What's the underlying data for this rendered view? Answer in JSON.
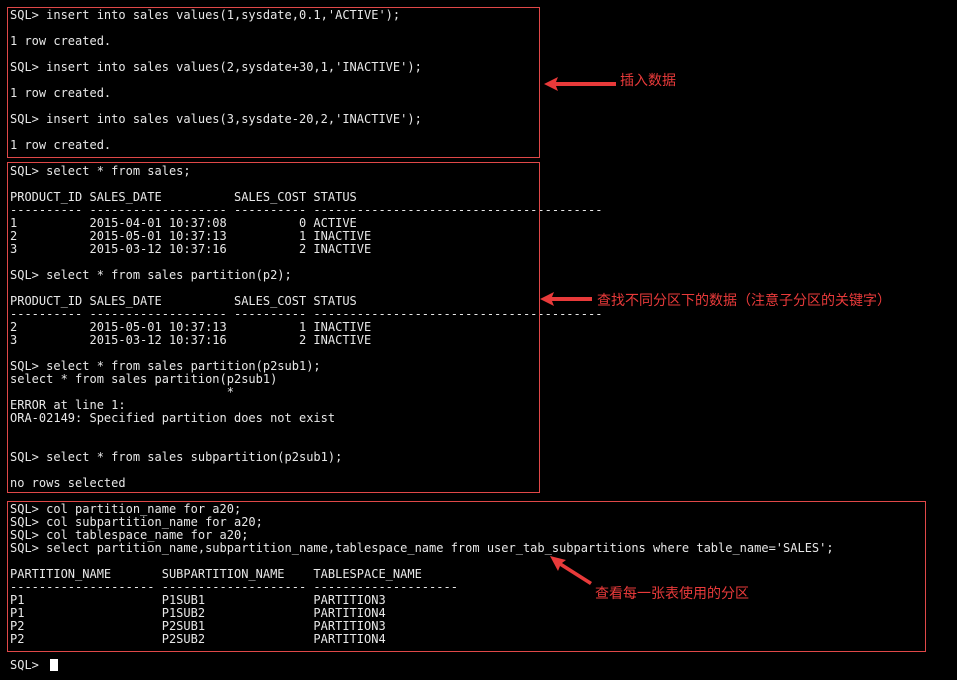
{
  "terminal": {
    "lines": [
      "SQL> insert into sales values(1,sysdate,0.1,'ACTIVE');",
      "",
      "1 row created.",
      "",
      "SQL> insert into sales values(2,sysdate+30,1,'INACTIVE');",
      "",
      "1 row created.",
      "",
      "SQL> insert into sales values(3,sysdate-20,2,'INACTIVE');",
      "",
      "1 row created.",
      "",
      "SQL> select * from sales;",
      "",
      "PRODUCT_ID SALES_DATE          SALES_COST STATUS",
      "---------- ------------------- ---------- ----------------------------------------",
      "1          2015-04-01 10:37:08          0 ACTIVE",
      "2          2015-05-01 10:37:13          1 INACTIVE",
      "3          2015-03-12 10:37:16          2 INACTIVE",
      "",
      "SQL> select * from sales partition(p2);",
      "",
      "PRODUCT_ID SALES_DATE          SALES_COST STATUS",
      "---------- ------------------- ---------- ----------------------------------------",
      "2          2015-05-01 10:37:13          1 INACTIVE",
      "3          2015-03-12 10:37:16          2 INACTIVE",
      "",
      "SQL> select * from sales partition(p2sub1);",
      "select * from sales partition(p2sub1)",
      "                              *",
      "",
      "ERROR at line 1:",
      "ORA-02149: Specified partition does not exist",
      "",
      "",
      "SQL> select * from sales subpartition(p2sub1);",
      "",
      "no rows selected",
      "",
      "SQL> col partition_name for a20;",
      "SQL> col subpartition_name for a20;",
      "SQL> col tablespace_name for a20;",
      "SQL> select partition_name,subpartition_name,tablespace_name from user_tab_subpartitions where table_name='SALES';",
      "",
      "PARTITION_NAME       SUBPARTITION_NAME    TABLESPACE_NAME",
      "-------------------- -------------------- --------------------",
      "P1                   P1SUB1               PARTITION3",
      "P1                   P1SUB2               PARTITION4",
      "P2                   P2SUB1               PARTITION3",
      "P2                   P2SUB2               PARTITION4",
      "",
      "SQL> "
    ],
    "text_color": "#e8e8e8",
    "background": "#000000"
  },
  "annotations": {
    "insert_note": "插入数据",
    "query_note": "查找不同分区下的数据（注意子分区的关键字）",
    "subpartition_note": "查看每一张表使用的分区",
    "color": "#e83a3a"
  }
}
